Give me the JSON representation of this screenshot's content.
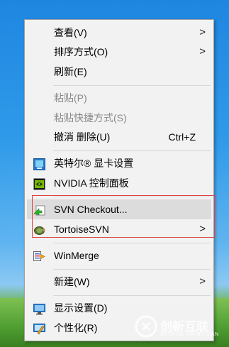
{
  "menu": {
    "items": [
      {
        "label": "查看(V)",
        "has_submenu": true,
        "enabled": true
      },
      {
        "label": "排序方式(O)",
        "has_submenu": true,
        "enabled": true
      },
      {
        "label": "刷新(E)",
        "has_submenu": false,
        "enabled": true
      },
      {
        "label": "粘贴(P)",
        "has_submenu": false,
        "enabled": false
      },
      {
        "label": "粘贴快捷方式(S)",
        "has_submenu": false,
        "enabled": false
      },
      {
        "label": "撤消 删除(U)",
        "shortcut": "Ctrl+Z",
        "has_submenu": false,
        "enabled": true
      },
      {
        "label": "英特尔® 显卡设置",
        "icon": "intel-graphics-icon",
        "has_submenu": false,
        "enabled": true
      },
      {
        "label": "NVIDIA 控制面板",
        "icon": "nvidia-icon",
        "has_submenu": false,
        "enabled": true
      },
      {
        "label": "SVN Checkout...",
        "icon": "svn-checkout-icon",
        "has_submenu": false,
        "enabled": true,
        "hovered": true
      },
      {
        "label": "TortoiseSVN",
        "icon": "tortoisesvn-icon",
        "has_submenu": true,
        "enabled": true
      },
      {
        "label": "WinMerge",
        "icon": "winmerge-icon",
        "has_submenu": false,
        "enabled": true
      },
      {
        "label": "新建(W)",
        "has_submenu": true,
        "enabled": true
      },
      {
        "label": "显示设置(D)",
        "icon": "display-settings-icon",
        "has_submenu": false,
        "enabled": true
      },
      {
        "label": "个性化(R)",
        "icon": "personalize-icon",
        "has_submenu": false,
        "enabled": true
      }
    ],
    "submenu_arrow": ">"
  },
  "watermark": {
    "text": "创新互联",
    "subtext": "CHUANG XIN HU LIAN"
  },
  "colors": {
    "menu_bg": "#f2f2f2",
    "hover_bg": "#dcdcdc",
    "disabled_text": "#8a8a8a",
    "highlight_border": "#e04040"
  }
}
